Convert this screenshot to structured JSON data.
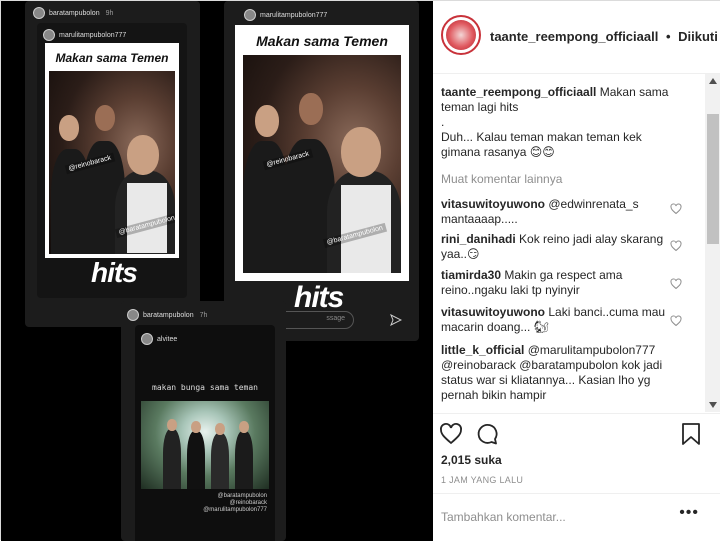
{
  "header": {
    "username": "taante_reempong_officiaall",
    "separator": "•",
    "follow_status": "Diikuti"
  },
  "caption": {
    "username": "taante_reempong_officiaall",
    "line1": "Makan sama teman lagi hits",
    "dot": ".",
    "line2": "Duh... Kalau teman makan teman kek gimana rasanya 😊😊"
  },
  "load_more": "Muat komentar lainnya",
  "comments": [
    {
      "username": "vitasuwitoyuwono",
      "text": "@edwinrenata_s mantaaaap....."
    },
    {
      "username": "rini_danihadi",
      "text": "Kok reino jadi alay skarang yaa..😏"
    },
    {
      "username": "tiamirda30",
      "text": "Makin ga respect ama reino..ngaku laki tp nyinyir"
    },
    {
      "username": "vitasuwitoyuwono",
      "text": "Laki banci..cuma mau macarin doang... 🐿"
    },
    {
      "username": "little_k_official",
      "text": "@marulitampubolon777 @reinobarack @baratampubolon kok jadi status war si kliatannya... Kasian lho yg pernah bikin hampir"
    }
  ],
  "likes": "2,015 suka",
  "timestamp": "1 JAM YANG LALU",
  "comment_input": {
    "placeholder": "Tambahkan komentar...",
    "more": "•••"
  },
  "media": {
    "story1": {
      "user": "baratampubolon",
      "time": "9h",
      "inner_user": "marulitampubolon777",
      "caption": "Makan sama Temen",
      "tags": [
        "@reinobarack",
        "@baratampubolon"
      ],
      "hits": "hits"
    },
    "story2": {
      "user": "marulitampubolon777",
      "caption": "Makan sama Temen",
      "tags": [
        "@reinobarack",
        "@baratampubolon"
      ],
      "hits": "hits",
      "msg": "ssage"
    },
    "story3": {
      "user": "baratampubolon",
      "time": "7h",
      "inner_user": "alvitee",
      "caption": "makan bunga sama teman",
      "tags": [
        "@baratampubolon",
        "@reinobarack",
        "@marulitampubolon777"
      ]
    }
  },
  "colors": {
    "accent_red": "#c8323a",
    "muted": "#8e8e8e",
    "text": "#262626"
  }
}
